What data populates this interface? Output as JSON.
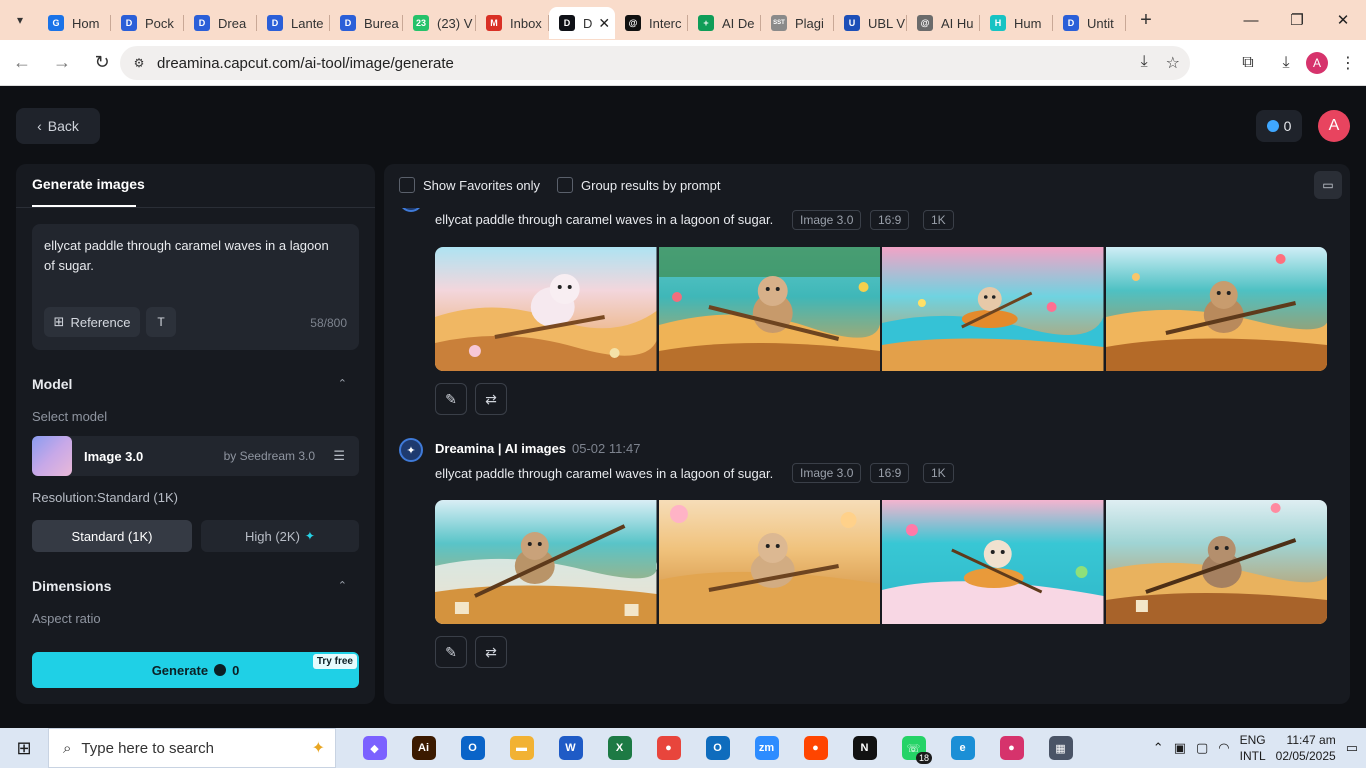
{
  "browser": {
    "tabs": [
      {
        "label": "Hom",
        "color": "#1a73e8",
        "glyph": "G"
      },
      {
        "label": "Pock",
        "color": "#2b5fd8",
        "glyph": "D"
      },
      {
        "label": "Drea",
        "color": "#2b5fd8",
        "glyph": "D"
      },
      {
        "label": "Lante",
        "color": "#2b5fd8",
        "glyph": "D"
      },
      {
        "label": "Burea",
        "color": "#2b5fd8",
        "glyph": "D"
      },
      {
        "label": "(23) V",
        "color": "#25c26a",
        "glyph": "23"
      },
      {
        "label": "Inbox",
        "color": "#d93025",
        "glyph": "M"
      },
      {
        "label": "D",
        "color": "#0f1117",
        "glyph": "D",
        "active": true
      },
      {
        "label": "Interc",
        "color": "#111111",
        "glyph": "@"
      },
      {
        "label": "AI De",
        "color": "#0f9d58",
        "glyph": "+"
      },
      {
        "label": "Plagi",
        "color": "#8a8a8a",
        "glyph": "SST"
      },
      {
        "label": "UBL V",
        "color": "#1d4fb8",
        "glyph": "U"
      },
      {
        "label": "AI Hu",
        "color": "#6b6b6b",
        "glyph": "@"
      },
      {
        "label": "Hum",
        "color": "#17c3c3",
        "glyph": "H"
      },
      {
        "label": "Untit",
        "color": "#2b5fd8",
        "glyph": "D"
      }
    ],
    "url": "dreamina.capcut.com/ai-tool/image/generate",
    "profile_initial": "A"
  },
  "header": {
    "back_label": "Back",
    "credits": "0",
    "avatar_initial": "A"
  },
  "left": {
    "tab_label": "Generate images",
    "prompt_text": "ellycat paddle through caramel waves in a lagoon of sugar.",
    "reference_label": "Reference",
    "char_count": "58/800",
    "model_section": "Model",
    "select_model_label": "Select model",
    "model_name": "Image 3.0",
    "model_by": "by Seedream 3.0",
    "resolution_label": "Resolution:Standard (1K)",
    "res_standard": "Standard (1K)",
    "res_high": "High (2K)",
    "dimensions_section": "Dimensions",
    "aspect_label": "Aspect ratio",
    "generate_label": "Generate",
    "generate_cost": "0",
    "try_free": "Try free"
  },
  "right": {
    "show_favorites": "Show Favorites only",
    "group_by_prompt": "Group results by prompt",
    "groups": [
      {
        "author": "",
        "time": "",
        "prompt": "ellycat paddle through caramel waves in a lagoon of sugar.",
        "tags": [
          "Image 3.0",
          "16:9",
          "1K"
        ]
      },
      {
        "author": "Dreamina | AI images",
        "time": "05-02   11:47",
        "prompt": "ellycat paddle through caramel waves in a lagoon of sugar.",
        "tags": [
          "Image 3.0",
          "16:9",
          "1K"
        ]
      }
    ]
  },
  "taskbar": {
    "search_placeholder": "Type here to search",
    "lang_line1": "ENG",
    "lang_line2": "INTL",
    "time": "11:47 am",
    "date": "02/05/2025",
    "whatsapp_badge": "18",
    "apps": [
      {
        "name": "copilot",
        "color": "#7b61ff",
        "glyph": "◆"
      },
      {
        "name": "illustrator",
        "color": "#3b1a00",
        "glyph": "Ai"
      },
      {
        "name": "outlook",
        "color": "#0a64c8",
        "glyph": "O"
      },
      {
        "name": "file-explorer",
        "color": "#f2b233",
        "glyph": "▬"
      },
      {
        "name": "word",
        "color": "#1f5bc6",
        "glyph": "W"
      },
      {
        "name": "excel",
        "color": "#1d7a44",
        "glyph": "X"
      },
      {
        "name": "chrome",
        "color": "#e8453c",
        "glyph": "●"
      },
      {
        "name": "outlook-new",
        "color": "#0f6cbd",
        "glyph": "O"
      },
      {
        "name": "zoom",
        "color": "#2d8cff",
        "glyph": "zm"
      },
      {
        "name": "reddit",
        "color": "#ff4500",
        "glyph": "●"
      },
      {
        "name": "netflix",
        "color": "#111111",
        "glyph": "N"
      },
      {
        "name": "whatsapp",
        "color": "#25d366",
        "glyph": "☏"
      },
      {
        "name": "edge",
        "color": "#1b8fd6",
        "glyph": "e"
      },
      {
        "name": "chrome-profile",
        "color": "#d6336c",
        "glyph": "●"
      },
      {
        "name": "calculator",
        "color": "#4a5466",
        "glyph": "▦"
      }
    ]
  }
}
